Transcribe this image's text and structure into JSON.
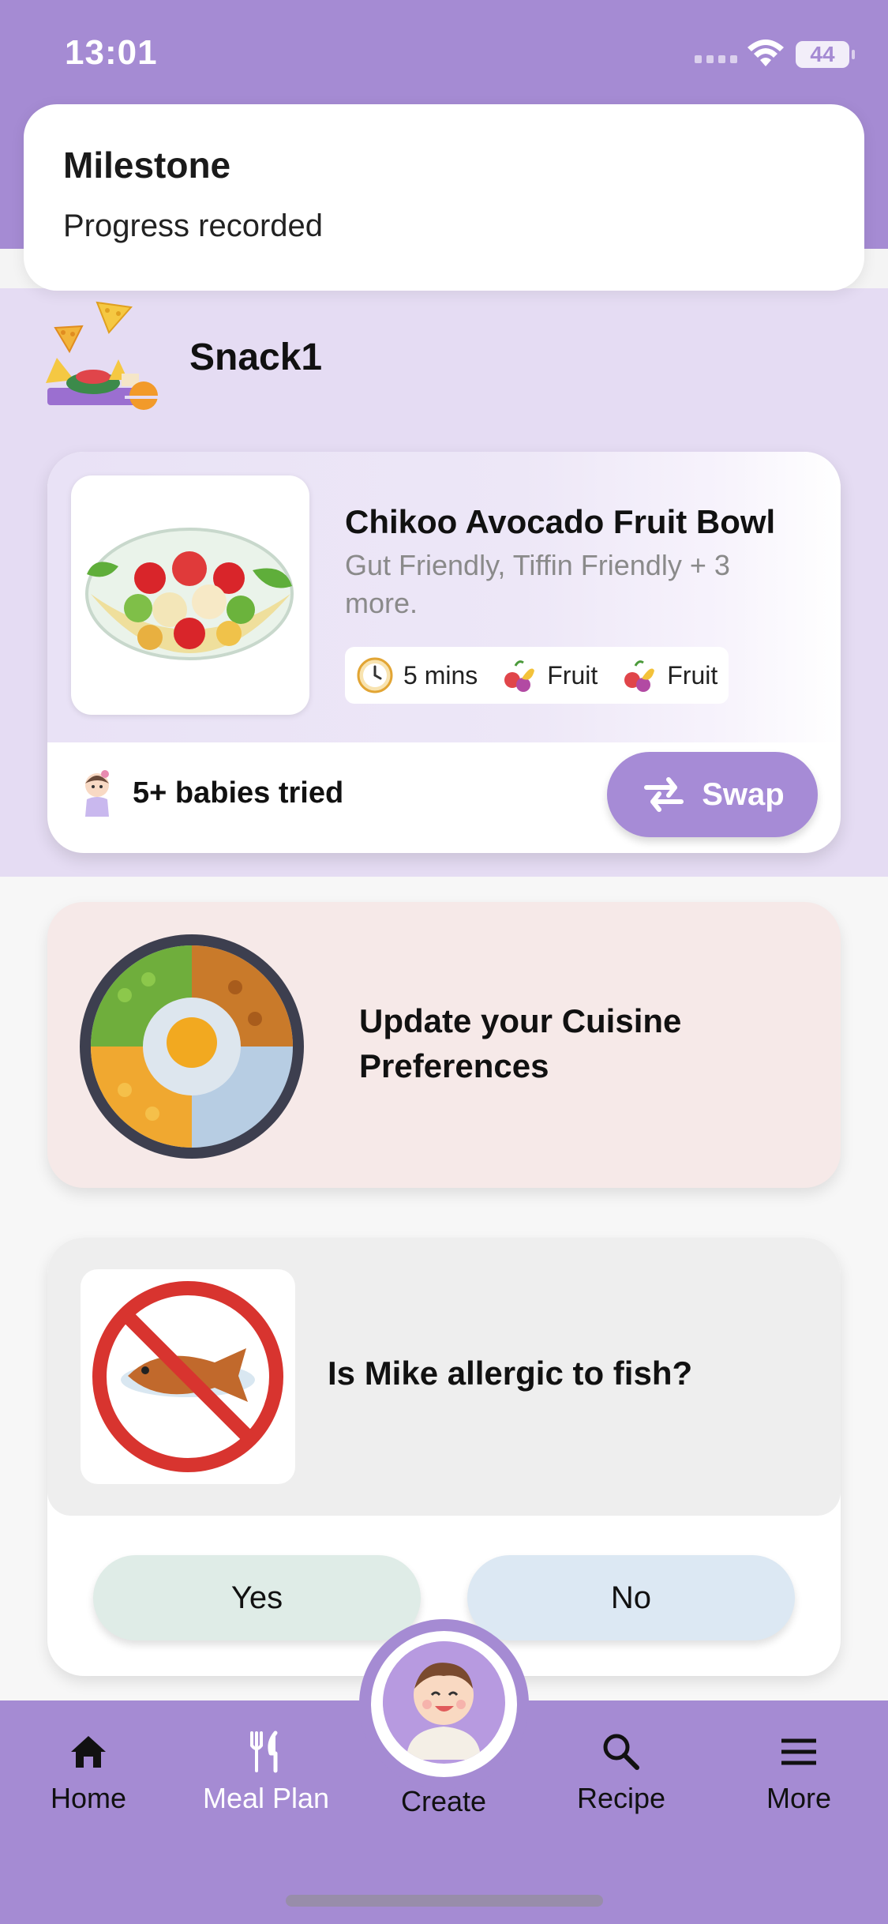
{
  "status_bar": {
    "time": "13:01",
    "battery": "44"
  },
  "notification": {
    "title": "Milestone",
    "body": "Progress recorded"
  },
  "snack": {
    "title": "Snack1",
    "recipe": {
      "name": "Chikoo Avocado Fruit Bowl",
      "tags": "Gut Friendly, Tiffin Friendly + 3 more.",
      "time": "5 mins",
      "category1": "Fruit",
      "category2": "Fruit",
      "babies_tried": "5+ babies tried",
      "swap_label": "Swap"
    }
  },
  "cuisine_card": {
    "text": "Update your Cuisine Preferences"
  },
  "allergy_card": {
    "question": "Is Mike allergic to fish?",
    "yes_label": "Yes",
    "no_label": "No"
  },
  "bottom_nav": {
    "items": [
      {
        "label": "Home",
        "icon": "home-icon",
        "color": "#111111"
      },
      {
        "label": "Meal Plan",
        "icon": "fork-knife-icon",
        "color": "#ffffff"
      },
      {
        "label": "Create",
        "icon": "baby-avatar",
        "color": "#111111"
      },
      {
        "label": "Recipe",
        "icon": "search-icon",
        "color": "#111111"
      },
      {
        "label": "More",
        "icon": "menu-icon",
        "color": "#111111"
      }
    ]
  },
  "colors": {
    "brand_purple": "#a58bd3",
    "snack_bg": "#e5dcf3",
    "swap_button": "#a68bd6",
    "cuisine_bg": "#f6e9e8"
  }
}
